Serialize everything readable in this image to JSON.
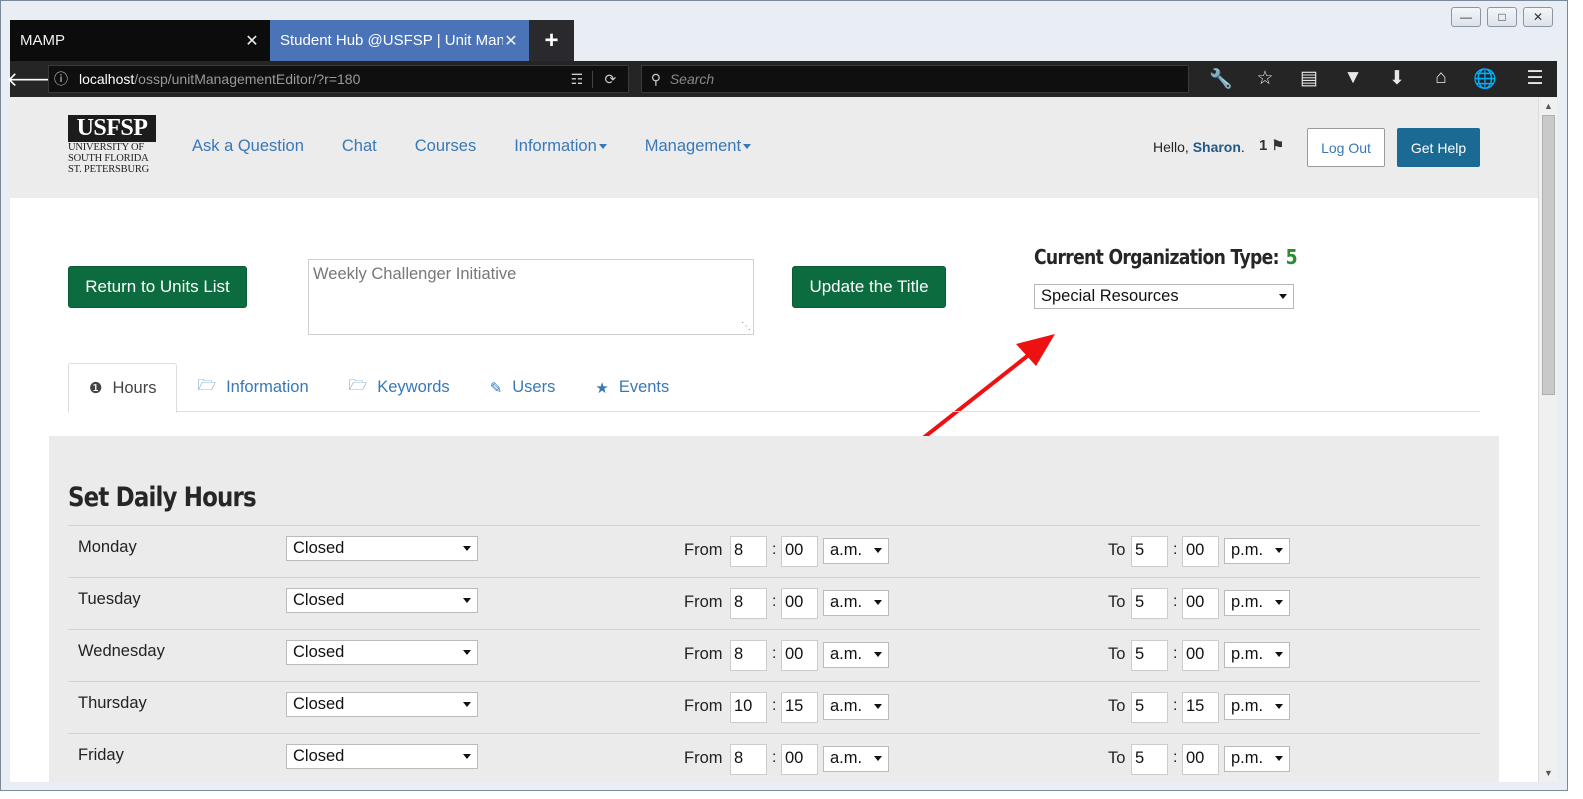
{
  "browser": {
    "tabs": [
      {
        "title": "MAMP",
        "active": false
      },
      {
        "title": "Student Hub @USFSP | Unit Management Editor",
        "active": true
      }
    ],
    "new_tab": "+",
    "url_host": "localhost",
    "url_path": "/ossp/unitManagementEditor/?r=180",
    "search_placeholder": "Search",
    "toolbar_icons": [
      "wrench-icon",
      "star-icon",
      "reading-list-icon",
      "pocket-icon",
      "download-icon",
      "home-icon",
      "globe-icon",
      "menu-icon"
    ]
  },
  "header": {
    "logo": {
      "mark": "USFSP",
      "lines": [
        "UNIVERSITY OF",
        "SOUTH FLORIDA",
        "ST. PETERSBURG"
      ]
    },
    "nav": [
      {
        "label": "Ask a Question",
        "dropdown": false
      },
      {
        "label": "Chat",
        "dropdown": false
      },
      {
        "label": "Courses",
        "dropdown": false
      },
      {
        "label": "Information",
        "dropdown": true
      },
      {
        "label": "Management",
        "dropdown": true
      }
    ],
    "greeting_prefix": "Hello, ",
    "user_name": "Sharon",
    "greeting_suffix": ".",
    "flag_count": "1",
    "logout_label": "Log Out",
    "help_label": "Get Help"
  },
  "editor": {
    "return_label": "Return to Units List",
    "unit_title": "Weekly Challenger Initiative",
    "update_label": "Update the Title",
    "org_type_label": "Current Organization Type:",
    "org_type_value": "5",
    "org_type_selected": "Special Resources"
  },
  "tabs": [
    {
      "label": "Hours",
      "icon": "info-circle-icon",
      "active": true
    },
    {
      "label": "Information",
      "icon": "folder-open-icon",
      "active": false
    },
    {
      "label": "Keywords",
      "icon": "folder-open-icon",
      "active": false
    },
    {
      "label": "Users",
      "icon": "pencil-icon",
      "active": false
    },
    {
      "label": "Events",
      "icon": "star-icon",
      "active": false
    }
  ],
  "hours": {
    "title": "Set Daily Hours",
    "from_label": "From",
    "to_label": "To",
    "colon": ":",
    "rows": [
      {
        "day": "Monday",
        "status": "Closed",
        "from_h": "8",
        "from_m": "00",
        "from_ampm": "a.m.",
        "to_h": "5",
        "to_m": "00",
        "to_ampm": "p.m."
      },
      {
        "day": "Tuesday",
        "status": "Closed",
        "from_h": "8",
        "from_m": "00",
        "from_ampm": "a.m.",
        "to_h": "5",
        "to_m": "00",
        "to_ampm": "p.m."
      },
      {
        "day": "Wednesday",
        "status": "Closed",
        "from_h": "8",
        "from_m": "00",
        "from_ampm": "a.m.",
        "to_h": "5",
        "to_m": "00",
        "to_ampm": "p.m."
      },
      {
        "day": "Thursday",
        "status": "Closed",
        "from_h": "10",
        "from_m": "15",
        "from_ampm": "a.m.",
        "to_h": "5",
        "to_m": "15",
        "to_ampm": "p.m."
      },
      {
        "day": "Friday",
        "status": "Closed",
        "from_h": "8",
        "from_m": "00",
        "from_ampm": "a.m.",
        "to_h": "5",
        "to_m": "00",
        "to_ampm": "p.m."
      }
    ]
  },
  "colors": {
    "brand_green": "#0c6b3f",
    "link_blue": "#3878b8",
    "help_blue": "#1a6a93",
    "annotation_red": "#ee1111"
  }
}
